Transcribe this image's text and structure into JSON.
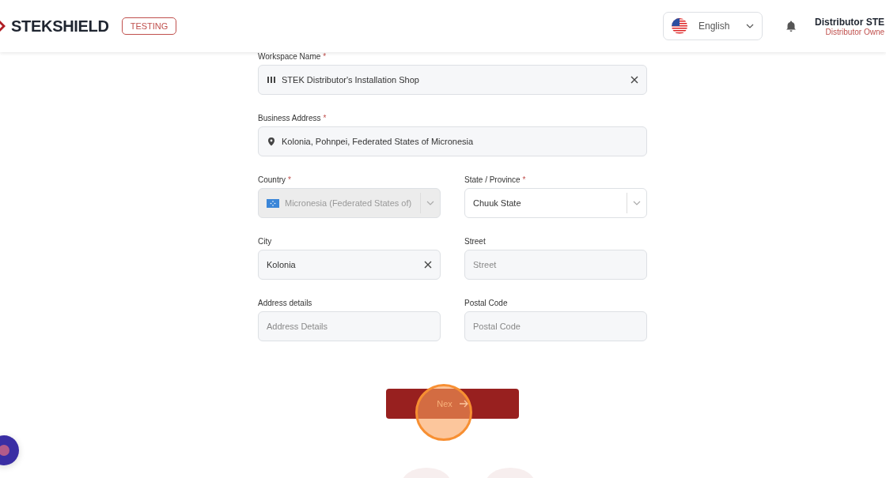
{
  "header": {
    "logo": "STEKSHIELD",
    "environment_badge": "TESTING",
    "language": "English",
    "user_name": "Distributor STE",
    "user_role": "Distributor Owne"
  },
  "form": {
    "fields": [
      {
        "kind": "workspace",
        "label": "Workspace Name",
        "required_mark": "*",
        "value": "STEK Distributor's Installation Shop",
        "disabled": false
      },
      {
        "kind": "address",
        "label": "Business Address",
        "required_mark": "*",
        "value": "Kolonia, Pohnpei, Federated States of Micronesia",
        "disabled": false
      },
      {
        "kind": "country",
        "label": "Country",
        "required_mark": "*",
        "value": "Micronesia (Federated States of)",
        "disabled": true
      },
      {
        "kind": "select",
        "label": "State / Province",
        "required_mark": "*",
        "value": "Chuuk State",
        "disabled": false
      },
      {
        "kind": "clearable",
        "label": "City",
        "value": "Kolonia",
        "disabled": false
      },
      {
        "kind": "text",
        "label": "Street",
        "placeholder": "Street",
        "disabled": false
      },
      {
        "kind": "text",
        "label": "Address details",
        "placeholder": "Address Details",
        "disabled": false
      },
      {
        "kind": "text",
        "label": "Postal Code",
        "placeholder": "Postal Code",
        "disabled": false
      }
    ],
    "next_button": "Nex"
  }
}
